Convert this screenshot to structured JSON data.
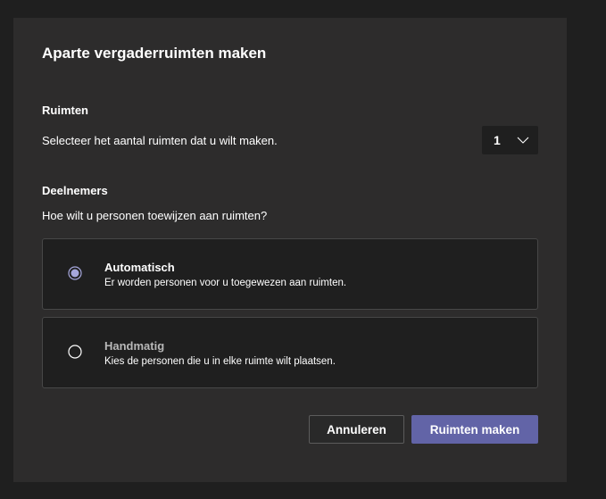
{
  "dialog": {
    "title": "Aparte vergaderruimten maken"
  },
  "rooms": {
    "heading": "Ruimten",
    "description": "Selecteer het aantal ruimten dat u wilt maken.",
    "count_selected": "1"
  },
  "participants": {
    "heading": "Deelnemers",
    "question": "Hoe wilt u personen toewijzen aan ruimten?",
    "options": [
      {
        "title": "Automatisch",
        "description": "Er worden personen voor u toegewezen aan ruimten.",
        "selected": true
      },
      {
        "title": "Handmatig",
        "description": "Kies de personen die u in elke ruimte wilt plaatsen.",
        "selected": false
      }
    ]
  },
  "buttons": {
    "cancel_label": "Annuleren",
    "create_label": "Ruimten maken"
  },
  "colors": {
    "accent": "#6264a7",
    "radio_selected": "#a6a7dc",
    "dialog_background": "#2d2c2c",
    "page_background": "#1f1f1f"
  },
  "icons": {
    "select_chevron": "chevron-down-icon",
    "radio_selected": "radio-selected-icon",
    "radio_unselected": "radio-unselected-icon"
  }
}
